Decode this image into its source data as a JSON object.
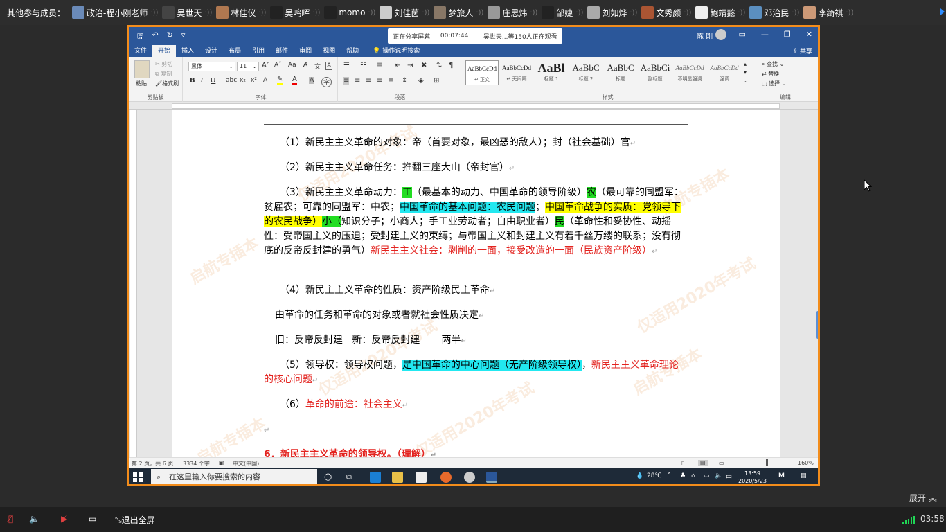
{
  "meeting": {
    "members_label": "其他参与成员：",
    "members": [
      {
        "name": "政治-程小刚老师",
        "avatar_color": "#6a8ab8"
      },
      {
        "name": "吴世天",
        "avatar_color": "#444"
      },
      {
        "name": "林佳仪",
        "avatar_color": "#b07850"
      },
      {
        "name": "吴鸣晖",
        "avatar_color": "#222"
      },
      {
        "name": "momo",
        "avatar_color": "#222"
      },
      {
        "name": "刘佳茵",
        "avatar_color": "#ccc"
      },
      {
        "name": "梦旅人",
        "avatar_color": "#887766"
      },
      {
        "name": "庄思炜",
        "avatar_color": "#999"
      },
      {
        "name": "邹婕",
        "avatar_color": "#222"
      },
      {
        "name": "刘如烨",
        "avatar_color": "#aaa"
      },
      {
        "name": "文秀颜",
        "avatar_color": "#aa5533"
      },
      {
        "name": "鲍靖懿",
        "avatar_color": "#eee"
      },
      {
        "name": "邓治民",
        "avatar_color": "#5b8fc0"
      },
      {
        "name": "李绮祺",
        "avatar_color": "#cc9977"
      }
    ],
    "sharing_text": "正在分享屏幕",
    "sharing_time": "00:07:44",
    "viewers_text": "吴世天...等150人正在观看",
    "expand_label": "展开",
    "exit_fullscreen": "退出全屏",
    "net_time": "03:58",
    "border_color": "#f28c1b"
  },
  "word": {
    "user": "陈 刚",
    "tabs": [
      "文件",
      "开始",
      "插入",
      "设计",
      "布局",
      "引用",
      "邮件",
      "审阅",
      "视图",
      "帮助"
    ],
    "tell_me": "操作说明搜索",
    "share": "共享",
    "clipboard": {
      "paste": "粘贴",
      "cut": "剪切",
      "copy": "复制",
      "format": "格式刷",
      "group": "剪贴板"
    },
    "font": {
      "name": "黑体",
      "size": "11",
      "group": "字体"
    },
    "paragraph_group": "段落",
    "styles_group": "样式",
    "styles": [
      {
        "sample": "AaBbCcDd",
        "name": "↵ 正文"
      },
      {
        "sample": "AaBbCcDd",
        "name": "↵ 无间隔"
      },
      {
        "sample": "AaBl",
        "name": "标题 1"
      },
      {
        "sample": "AaBbC",
        "name": "标题 2"
      },
      {
        "sample": "AaBbC",
        "name": "标题"
      },
      {
        "sample": "AaBbCi",
        "name": "副标题"
      },
      {
        "sample": "AaBbCcDd",
        "name": "不明显强调"
      },
      {
        "sample": "AaBbCcDd",
        "name": "强调"
      }
    ],
    "editing": {
      "find": "查找",
      "replace": "替换",
      "select": "选择",
      "group": "编辑"
    },
    "brand_color": "#2b579a"
  },
  "doc": {
    "watermarks": [
      "仅适用2020年考试",
      "启航专插本"
    ],
    "l1": "（1）新民主主义革命的对象：帝（首要对象，最凶恶的敌人）；封（社会基础）官",
    "l2": "（2）新民主主义革命任务：推翻三座大山（帝封官）",
    "l3": {
      "a": "（3）新民主主义革命动力：",
      "b": "工",
      "c": "（最基本的动力、中国革命的领导阶级）",
      "d": "农",
      "e": "（最可靠的同盟军：贫雇农；可靠的同盟军：中农；",
      "f": "中国革命的基本问题：农民问题",
      "g": "；",
      "h": "中国革命战争的实质：党领导下的农民战争",
      "i": "）",
      "j": "小（",
      "k": "知识分子；小商人；手工业劳动者；自由职业者）",
      "l": "民",
      "m": "（革命性和妥协性、动摇性：受帝国主义的压迫；受封建主义的束缚；与帝国主义和封建主义有着千丝万缕的联系；没有彻底的反帝反封建的勇气）",
      "n": "新民主主义社会：剥削的一面，接受改造的一面（民族资产阶级）"
    },
    "l4": "（4）新民主主义革命的性质：资产阶级民主革命",
    "l5": "由革命的任务和革命的对象或者就社会性质决定",
    "l6": "旧：反帝反封建   新：反帝反封建       两半",
    "l7": {
      "a": "（5）领导权：领导权问题，",
      "b": "是中国革命的中心问题（无产阶级领导权）",
      "c": "，",
      "d": "新民主主义革命理论的核心问题"
    },
    "l8": {
      "a": "（6）",
      "b": "革命的前途：社会主义"
    },
    "l9": "6．新民主主义革命的领导权。（理解）"
  },
  "status": {
    "page": "第 2 页，共 6 页",
    "words": "3334 个字",
    "lang": "中文(中国)",
    "zoom": "160%"
  },
  "taskbar": {
    "search_placeholder": "在这里输入你要搜索的内容",
    "temp": "28℃",
    "ime": "中",
    "time": "13:59",
    "date": "2020/5/23"
  }
}
